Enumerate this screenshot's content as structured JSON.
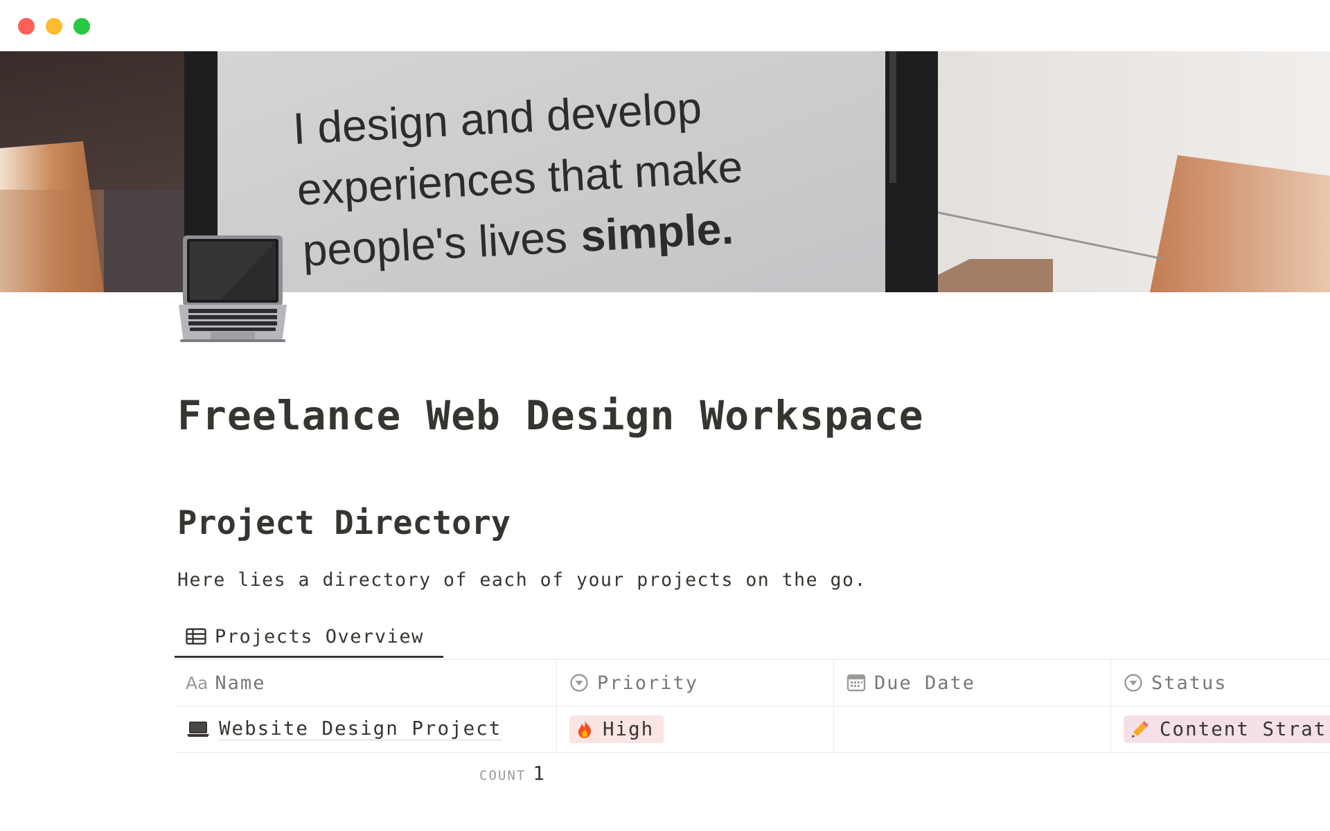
{
  "window": {
    "controls": [
      "close",
      "minimize",
      "maximize"
    ]
  },
  "cover": {
    "description_text": [
      "I design and develop",
      "experiences that make",
      "people's lives",
      "simple."
    ]
  },
  "page": {
    "icon": "laptop-icon",
    "title": "Freelance Web Design Workspace"
  },
  "section": {
    "heading": "Project Directory",
    "description": "Here lies a directory of each of your projects on the go."
  },
  "view": {
    "tab_label": "Projects Overview",
    "tab_icon": "table-icon"
  },
  "table": {
    "columns": [
      {
        "label": "Name",
        "icon": "text-property-icon"
      },
      {
        "label": "Priority",
        "icon": "select-property-icon"
      },
      {
        "label": "Due Date",
        "icon": "calendar-icon"
      },
      {
        "label": "Status",
        "icon": "select-property-icon"
      }
    ],
    "rows": [
      {
        "name": "Website Design Project",
        "name_icon": "laptop-icon",
        "priority": "High",
        "priority_icon": "fire-icon",
        "due_date": "",
        "status": "Content Strat",
        "status_icon": "pencil-icon"
      }
    ],
    "count_label": "COUNT",
    "count_value": "1"
  },
  "colors": {
    "text": "#37352f",
    "muted": "#787774",
    "priority_tag_bg": "#fbe4e4",
    "status_tag_bg": "#f5e0e9",
    "border": "#e9e9e7"
  }
}
